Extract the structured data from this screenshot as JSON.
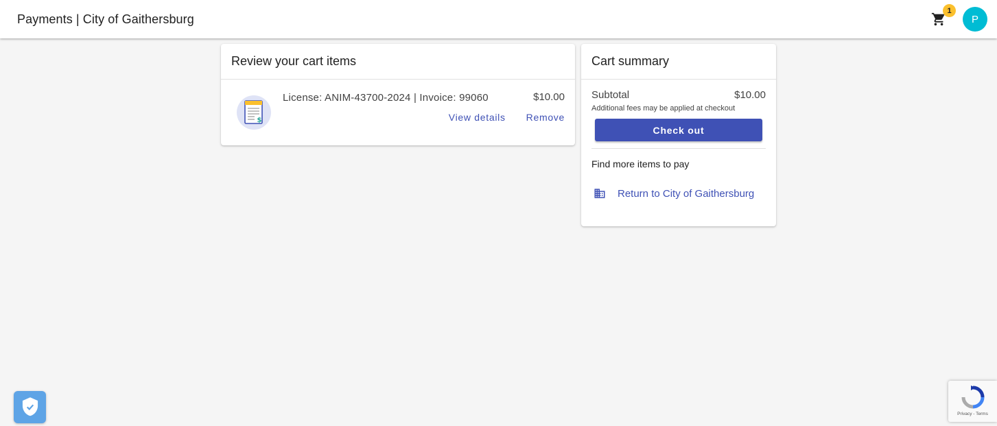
{
  "header": {
    "title": "Payments | City of Gaithersburg",
    "cart_count": "1",
    "avatar_initial": "P",
    "cart_icon": "shopping-cart-icon"
  },
  "cart": {
    "title": "Review your cart items",
    "items": [
      {
        "description": "License: ANIM-43700-2024 | Invoice: 99060",
        "price": "$10.00",
        "view_details_label": "View details",
        "remove_label": "Remove",
        "icon": "invoice-document-icon"
      }
    ]
  },
  "summary": {
    "title": "Cart summary",
    "subtotal_label": "Subtotal",
    "subtotal_value": "$10.00",
    "fee_note": "Additional fees may be applied at checkout",
    "checkout_label": "Check out",
    "find_more_label": "Find more items to pay",
    "return_label": "Return to City of Gaithersburg",
    "return_icon": "building-icon"
  },
  "recaptcha": {
    "privacy_label": "Privacy",
    "separator": " - ",
    "terms_label": "Terms"
  },
  "colors": {
    "primary": "#3f51b5",
    "badge": "#fbc02d",
    "avatar": "#00bcd4",
    "background": "#f5f5f5",
    "shield": "#5ea4e6"
  }
}
